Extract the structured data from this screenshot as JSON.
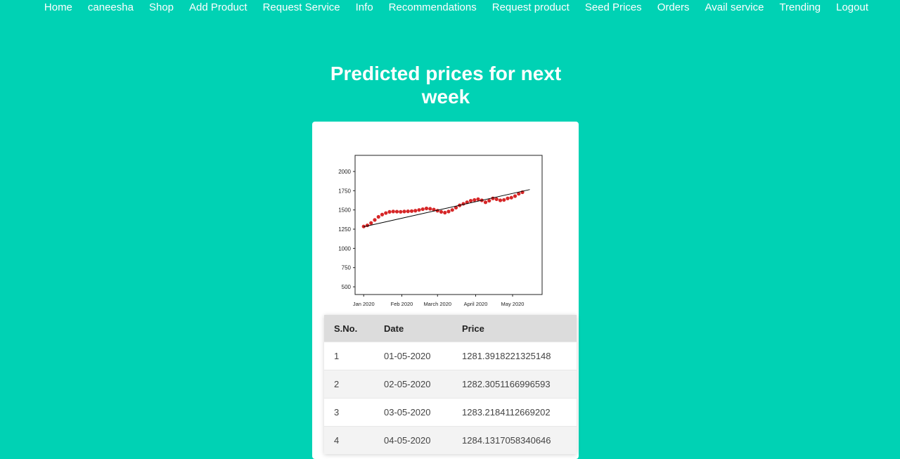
{
  "nav": {
    "items": [
      "Home",
      "caneesha",
      "Shop",
      "Add Product",
      "Request Service",
      "Info",
      "Recommendations",
      "Request product",
      "Seed Prices",
      "Orders",
      "Avail service",
      "Trending",
      "Logout"
    ]
  },
  "page": {
    "title": "Predicted prices for next week"
  },
  "chart_data": {
    "type": "scatter",
    "title": "",
    "xlabel": "",
    "ylabel": "",
    "x_ticks": [
      "Jan 2020",
      "Feb 2020",
      "March 2020",
      "April 2020",
      "May 2020"
    ],
    "y_ticks": [
      500,
      750,
      1000,
      1250,
      1500,
      1750,
      2000
    ],
    "ylim": [
      400,
      2210
    ],
    "grid": false,
    "series": [
      {
        "kind": "scatter",
        "color": "#d62728",
        "x": [
          "2020-01-01",
          "2020-01-04",
          "2020-01-07",
          "2020-01-10",
          "2020-01-13",
          "2020-01-16",
          "2020-01-19",
          "2020-01-22",
          "2020-01-25",
          "2020-01-28",
          "2020-01-31",
          "2020-02-03",
          "2020-02-06",
          "2020-02-09",
          "2020-02-12",
          "2020-02-15",
          "2020-02-18",
          "2020-02-21",
          "2020-02-24",
          "2020-02-27",
          "2020-03-01",
          "2020-03-04",
          "2020-03-07",
          "2020-03-10",
          "2020-03-13",
          "2020-03-16",
          "2020-03-19",
          "2020-03-22",
          "2020-03-25",
          "2020-03-28",
          "2020-03-31",
          "2020-04-03",
          "2020-04-06",
          "2020-04-09",
          "2020-04-12",
          "2020-04-15",
          "2020-04-18",
          "2020-04-21",
          "2020-04-24",
          "2020-04-27",
          "2020-04-30",
          "2020-05-03",
          "2020-05-06",
          "2020-05-09"
        ],
        "y": [
          1285,
          1300,
          1330,
          1370,
          1410,
          1440,
          1460,
          1475,
          1480,
          1478,
          1476,
          1480,
          1482,
          1485,
          1490,
          1500,
          1510,
          1520,
          1515,
          1505,
          1490,
          1475,
          1465,
          1480,
          1500,
          1530,
          1560,
          1580,
          1600,
          1620,
          1630,
          1640,
          1625,
          1600,
          1620,
          1650,
          1640,
          1625,
          1630,
          1650,
          1660,
          1680,
          1710,
          1730
        ]
      },
      {
        "kind": "line",
        "color": "#000000",
        "x": [
          "2020-01-01",
          "2020-05-15"
        ],
        "y": [
          1281.39,
          1765
        ]
      }
    ]
  },
  "table": {
    "headers": [
      "S.No.",
      "Date",
      "Price"
    ],
    "rows": [
      [
        "1",
        "01-05-2020",
        "1281.3918221325148"
      ],
      [
        "2",
        "02-05-2020",
        "1282.3051166996593"
      ],
      [
        "3",
        "03-05-2020",
        "1283.2184112669202"
      ],
      [
        "4",
        "04-05-2020",
        "1284.1317058340646"
      ]
    ]
  }
}
